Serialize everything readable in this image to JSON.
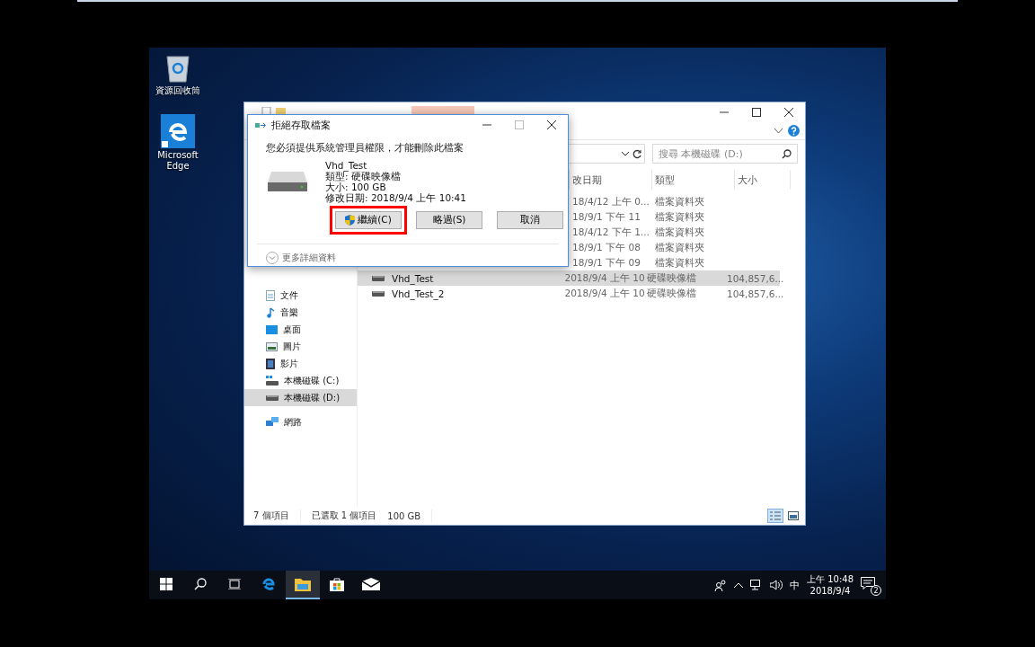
{
  "desktop": {
    "icons": [
      {
        "kind": "recycle-bin",
        "label": "資源回收筒"
      },
      {
        "kind": "edge",
        "label": "Microsoft Edge"
      }
    ]
  },
  "explorer": {
    "search": {
      "placeholder": "搜尋 本機磁碟 (D:)"
    },
    "columns": [
      "改日期",
      "類型",
      "大小"
    ],
    "sidebar": [
      {
        "kind": "documents",
        "label": "文件",
        "selected": false
      },
      {
        "kind": "music",
        "label": "音樂",
        "selected": false
      },
      {
        "kind": "desktop",
        "label": "桌面",
        "selected": false
      },
      {
        "kind": "pictures",
        "label": "圖片",
        "selected": false
      },
      {
        "kind": "videos",
        "label": "影片",
        "selected": false
      },
      {
        "kind": "drive-c",
        "label": "本機磁碟 (C:)",
        "selected": false
      },
      {
        "kind": "drive",
        "label": "本機磁碟 (D:)",
        "selected": true
      },
      {
        "kind": "network",
        "label": "網路",
        "selected": false
      }
    ],
    "rows": [
      {
        "date": "18/4/12 上午 0...",
        "type": "檔案資料夾",
        "selected": false
      },
      {
        "date": "18/9/1 下午 11",
        "type": "檔案資料夾",
        "selected": false
      },
      {
        "date": "18/4/12 下午 1...",
        "type": "檔案資料夾",
        "selected": false
      },
      {
        "date": "18/9/1 下午 08",
        "type": "檔案資料夾",
        "selected": false
      },
      {
        "date": "18/9/1 下午 09",
        "type": "檔案資料夾",
        "selected": false
      },
      {
        "name": "Vhd_Test",
        "date": "2018/9/4 上午 10",
        "type": "硬碟映像檔",
        "size": "104,857,6...",
        "selected": true
      },
      {
        "name": "Vhd_Test_2",
        "date": "2018/9/4 上午 10",
        "type": "硬碟映像檔",
        "size": "104,857,6...",
        "selected": false
      }
    ],
    "status_bar": {
      "count": "7 個項目",
      "selection": "已選取 1 個項目",
      "size": "100 GB"
    },
    "view_buttons": [
      {
        "kind": "details",
        "selected": true
      },
      {
        "kind": "large-icons",
        "selected": false
      }
    ]
  },
  "dialog": {
    "title": "拒絕存取檔案",
    "message": "您必須提供系統管理員權限，才能刪除此檔案",
    "file": {
      "name": "Vhd_Test",
      "lines": [
        "類型: 硬碟映像檔",
        "大小: 100 GB",
        "修改日期: 2018/9/4 上午 10:41"
      ]
    },
    "buttons": [
      {
        "label": "繼續(C)",
        "kind": "elevated",
        "highlighted": true
      },
      {
        "label": "略過(S)",
        "kind": "plain",
        "highlighted": false
      },
      {
        "label": "取消",
        "kind": "plain",
        "highlighted": false
      }
    ],
    "details_toggle": "更多詳細資料"
  },
  "taskbar": {
    "apps": [
      {
        "kind": "edge",
        "active": false
      },
      {
        "kind": "explorer",
        "active": true
      },
      {
        "kind": "store",
        "active": false
      },
      {
        "kind": "mail",
        "active": false
      }
    ],
    "ime": "中",
    "time": "上午 10:48",
    "date": "2018/9/4",
    "notifications": "2"
  }
}
